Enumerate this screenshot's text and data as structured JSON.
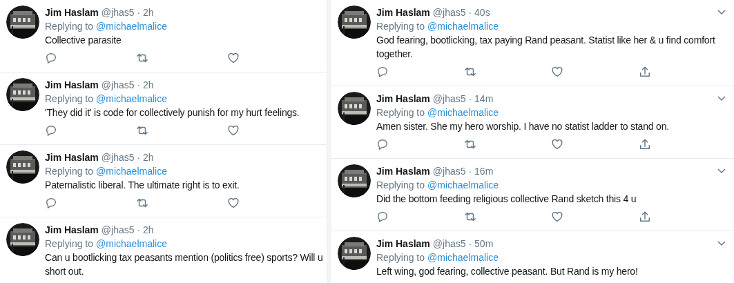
{
  "columns": [
    {
      "kind": "narrow",
      "tweets": [
        {
          "name": "Jim Haslam",
          "handle": "@jhas5",
          "time": "· 2h",
          "replying": "Replying to",
          "mention": "@michaelmalice",
          "lines": [
            "Collective parasite"
          ]
        },
        {
          "name": "Jim Haslam",
          "handle": "@jhas5",
          "time": "· 2h",
          "replying": "Replying to",
          "mention": "@michaelmalice",
          "lines": [
            "'They did it' is code for collectively punish for my hurt feelings."
          ]
        },
        {
          "name": "Jim Haslam",
          "handle": "@jhas5",
          "time": "· 2h",
          "replying": "Replying to",
          "mention": "@michaelmalice",
          "lines": [
            "Paternalistic liberal. The ultimate right is to exit."
          ]
        },
        {
          "name": "Jim Haslam",
          "handle": "@jhas5",
          "time": "· 2h",
          "replying": "Replying to",
          "mention": "@michaelmalice",
          "lines": [
            "Can u bootlicking tax peasants mention (politics free) sports? Will u",
            "short out."
          ]
        }
      ]
    },
    {
      "kind": "wide",
      "tweets": [
        {
          "name": "Jim Haslam",
          "handle": "@jhas5",
          "time": "· 40s",
          "replying": "Replying to",
          "mention": "@michaelmalice",
          "lines": [
            "God fearing, bootlicking, tax paying Rand peasant. Statist like her & u find comfort",
            "together."
          ]
        },
        {
          "name": "Jim Haslam",
          "handle": "@jhas5",
          "time": "· 14m",
          "replying": "Replying to",
          "mention": "@michaelmalice",
          "lines": [
            "Amen sister. She my hero worship. I have no statist ladder to stand on."
          ]
        },
        {
          "name": "Jim Haslam",
          "handle": "@jhas5",
          "time": "· 16m",
          "replying": "Replying to",
          "mention": "@michaelmalice",
          "lines": [
            "Did the bottom feeding religious collective Rand sketch this 4 u"
          ]
        },
        {
          "name": "Jim Haslam",
          "handle": "@jhas5",
          "time": "· 50m",
          "replying": "Replying to",
          "mention": "@michaelmalice",
          "lines": [
            "Left wing, god fearing, collective peasant. But Rand is my hero!"
          ]
        }
      ]
    }
  ]
}
